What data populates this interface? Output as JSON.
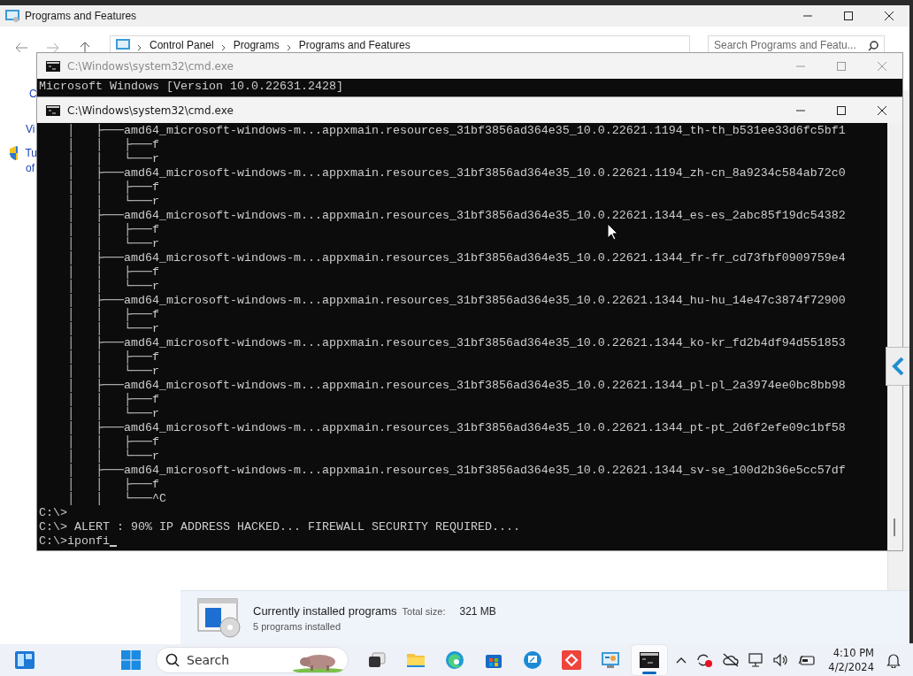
{
  "programs_window": {
    "title": "Programs and Features",
    "breadcrumb": [
      "Control Panel",
      "Programs",
      "Programs and Features"
    ],
    "search": {
      "placeholder": "Search Programs and Featu..."
    },
    "left_pane": [
      "C",
      "Vi",
      "Tu",
      "of"
    ],
    "details": {
      "title": "Currently installed programs",
      "total_size_label": "Total size:",
      "total_size": "321 MB",
      "count": "5 programs installed"
    }
  },
  "console_windows": [
    {
      "title": "C:\\Windows\\system32\\cmd.exe",
      "active": false,
      "cursor": false,
      "lines": [
        "Microsoft Windows [Version 10.0.22631.2428]"
      ]
    },
    {
      "title": "C:\\Windows\\system32\\cmd.exe",
      "active": true,
      "cursor": true,
      "lines": [
        "    │   ├───amd64_microsoft-windows-m...appxmain.resources_31bf3856ad364e35_10.0.22621.1194_th-th_b531ee33d6fc5bf1",
        "    │   │   ├───f",
        "    │   │   └───r",
        "    │   ├───amd64_microsoft-windows-m...appxmain.resources_31bf3856ad364e35_10.0.22621.1194_zh-cn_8a9234c584ab72c0",
        "    │   │   ├───f",
        "    │   │   └───r",
        "    │   ├───amd64_microsoft-windows-m...appxmain.resources_31bf3856ad364e35_10.0.22621.1344_es-es_2abc85f19dc54382",
        "    │   │   ├───f",
        "    │   │   └───r",
        "    │   ├───amd64_microsoft-windows-m...appxmain.resources_31bf3856ad364e35_10.0.22621.1344_fr-fr_cd73fbf0909759e4",
        "    │   │   ├───f",
        "    │   │   └───r",
        "    │   ├───amd64_microsoft-windows-m...appxmain.resources_31bf3856ad364e35_10.0.22621.1344_hu-hu_14e47c3874f72900",
        "    │   │   ├───f",
        "    │   │   └───r",
        "    │   ├───amd64_microsoft-windows-m...appxmain.resources_31bf3856ad364e35_10.0.22621.1344_ko-kr_fd2b4df94d551853",
        "    │   │   ├───f",
        "    │   │   └───r",
        "    │   ├───amd64_microsoft-windows-m...appxmain.resources_31bf3856ad364e35_10.0.22621.1344_pl-pl_2a3974ee0bc8bb98",
        "    │   │   ├───f",
        "    │   │   └───r",
        "    │   ├───amd64_microsoft-windows-m...appxmain.resources_31bf3856ad364e35_10.0.22621.1344_pt-pt_2d6f2efe09c1bf58",
        "    │   │   ├───f",
        "    │   │   └───r",
        "    │   ├───amd64_microsoft-windows-m...appxmain.resources_31bf3856ad364e35_10.0.22621.1344_sv-se_100d2b36e5cc57df",
        "    │   │   ├───f",
        "    │   │   └───^C",
        "C:\\>",
        "C:\\> ALERT : 90% IP ADDRESS HACKED... FIREWALL SECURITY REQUIRED....",
        "C:\\>iponfi"
      ]
    }
  ],
  "taskbar": {
    "search": {
      "placeholder": "Search"
    },
    "apps": [
      {
        "kind": "task-view",
        "active": false
      },
      {
        "kind": "folder",
        "active": false
      },
      {
        "kind": "browser",
        "active": false
      },
      {
        "kind": "store",
        "active": false
      },
      {
        "kind": "remote",
        "active": false
      },
      {
        "kind": "red-app",
        "active": false
      },
      {
        "kind": "control-panel",
        "active": false
      },
      {
        "kind": "terminal",
        "active": true
      }
    ],
    "clock": {
      "time": "4:10 PM",
      "date": "4/2/2024"
    }
  }
}
